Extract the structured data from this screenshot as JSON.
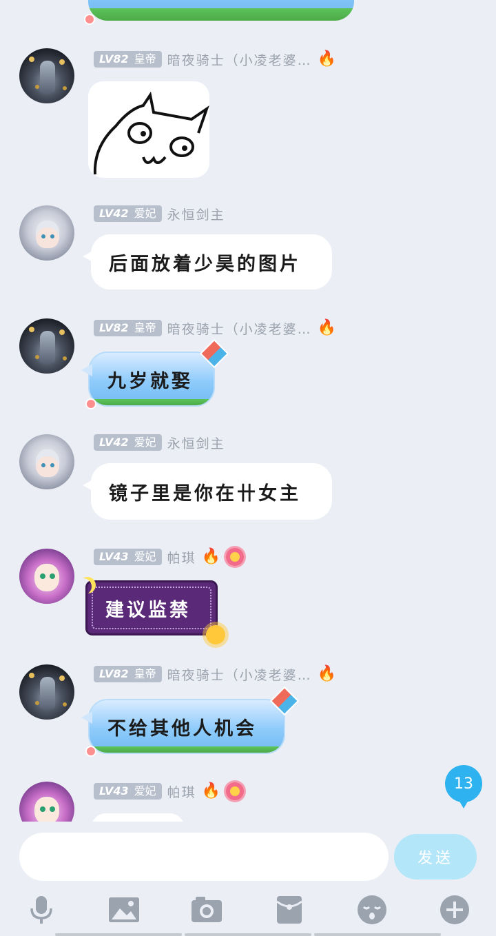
{
  "messages": [
    {
      "user": {
        "level": "LV82",
        "title": "皇帝",
        "name": "暗夜骑士（小凌老婆…"
      },
      "type": "sticker"
    },
    {
      "user": {
        "level": "LV42",
        "title": "爱妃",
        "name": "永恒剑主"
      },
      "text": "后面放着少昊的图片"
    },
    {
      "user": {
        "level": "LV82",
        "title": "皇帝",
        "name": "暗夜骑士（小凌老婆…"
      },
      "text": "九岁就娶"
    },
    {
      "user": {
        "level": "LV42",
        "title": "爱妃",
        "name": "永恒剑主"
      },
      "text": "镜子里是你在卄女主"
    },
    {
      "user": {
        "level": "LV43",
        "title": "爱妃",
        "name": "帕琪"
      },
      "text": "建议监禁"
    },
    {
      "user": {
        "level": "LV82",
        "title": "皇帝",
        "name": "暗夜骑士（小凌老婆…"
      },
      "text": "不给其他人机会"
    },
    {
      "user": {
        "level": "LV43",
        "title": "爱妃",
        "name": "帕琪"
      },
      "type": "sticker"
    }
  ],
  "unread_count": "13",
  "input": {
    "placeholder": "",
    "send_label": "发送"
  },
  "toolbar": [
    "mic-icon",
    "image-icon",
    "camera-icon",
    "red-packet-icon",
    "emoji-icon",
    "plus-icon"
  ],
  "colors": {
    "background": "#ebeff5",
    "unread": "#2fb3f0",
    "send": "#b3e6f8",
    "icon": "#9aa3ae"
  }
}
